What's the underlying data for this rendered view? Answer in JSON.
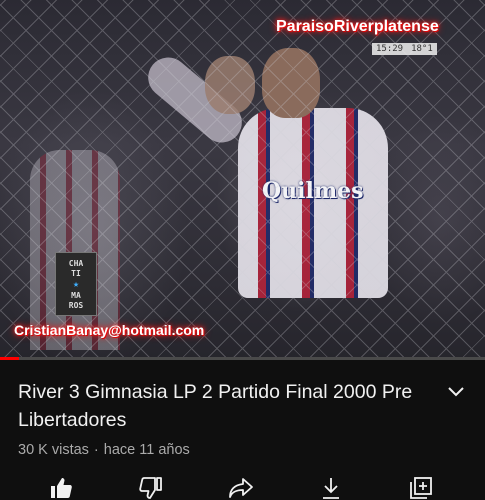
{
  "player": {
    "watermark": "ParaisoRiverplatense",
    "clock_time": "15:29",
    "clock_temp": "18°1",
    "email_overlay": "CristianBanay@hotmail.com",
    "sponsor_text": "Quilmes",
    "channel_logo": [
      "CHA",
      "TI",
      "MA",
      "ROS"
    ],
    "progress_fraction": 0.04,
    "progress_color": "#ff0000"
  },
  "video": {
    "title": "River 3 Gimnasia LP 2 Partido Final 2000 Pre Libertadores",
    "views": "30 K vistas",
    "separator": "·",
    "age": "hace 11 años"
  },
  "actions": {
    "icons": [
      "like-icon",
      "dislike-icon",
      "share-icon",
      "download-icon",
      "save-to-playlist-icon"
    ]
  },
  "colors": {
    "background": "#0f0f0f",
    "text_primary": "#f1f1f1",
    "text_secondary": "#aaaaaa",
    "accent": "#ff0000"
  }
}
